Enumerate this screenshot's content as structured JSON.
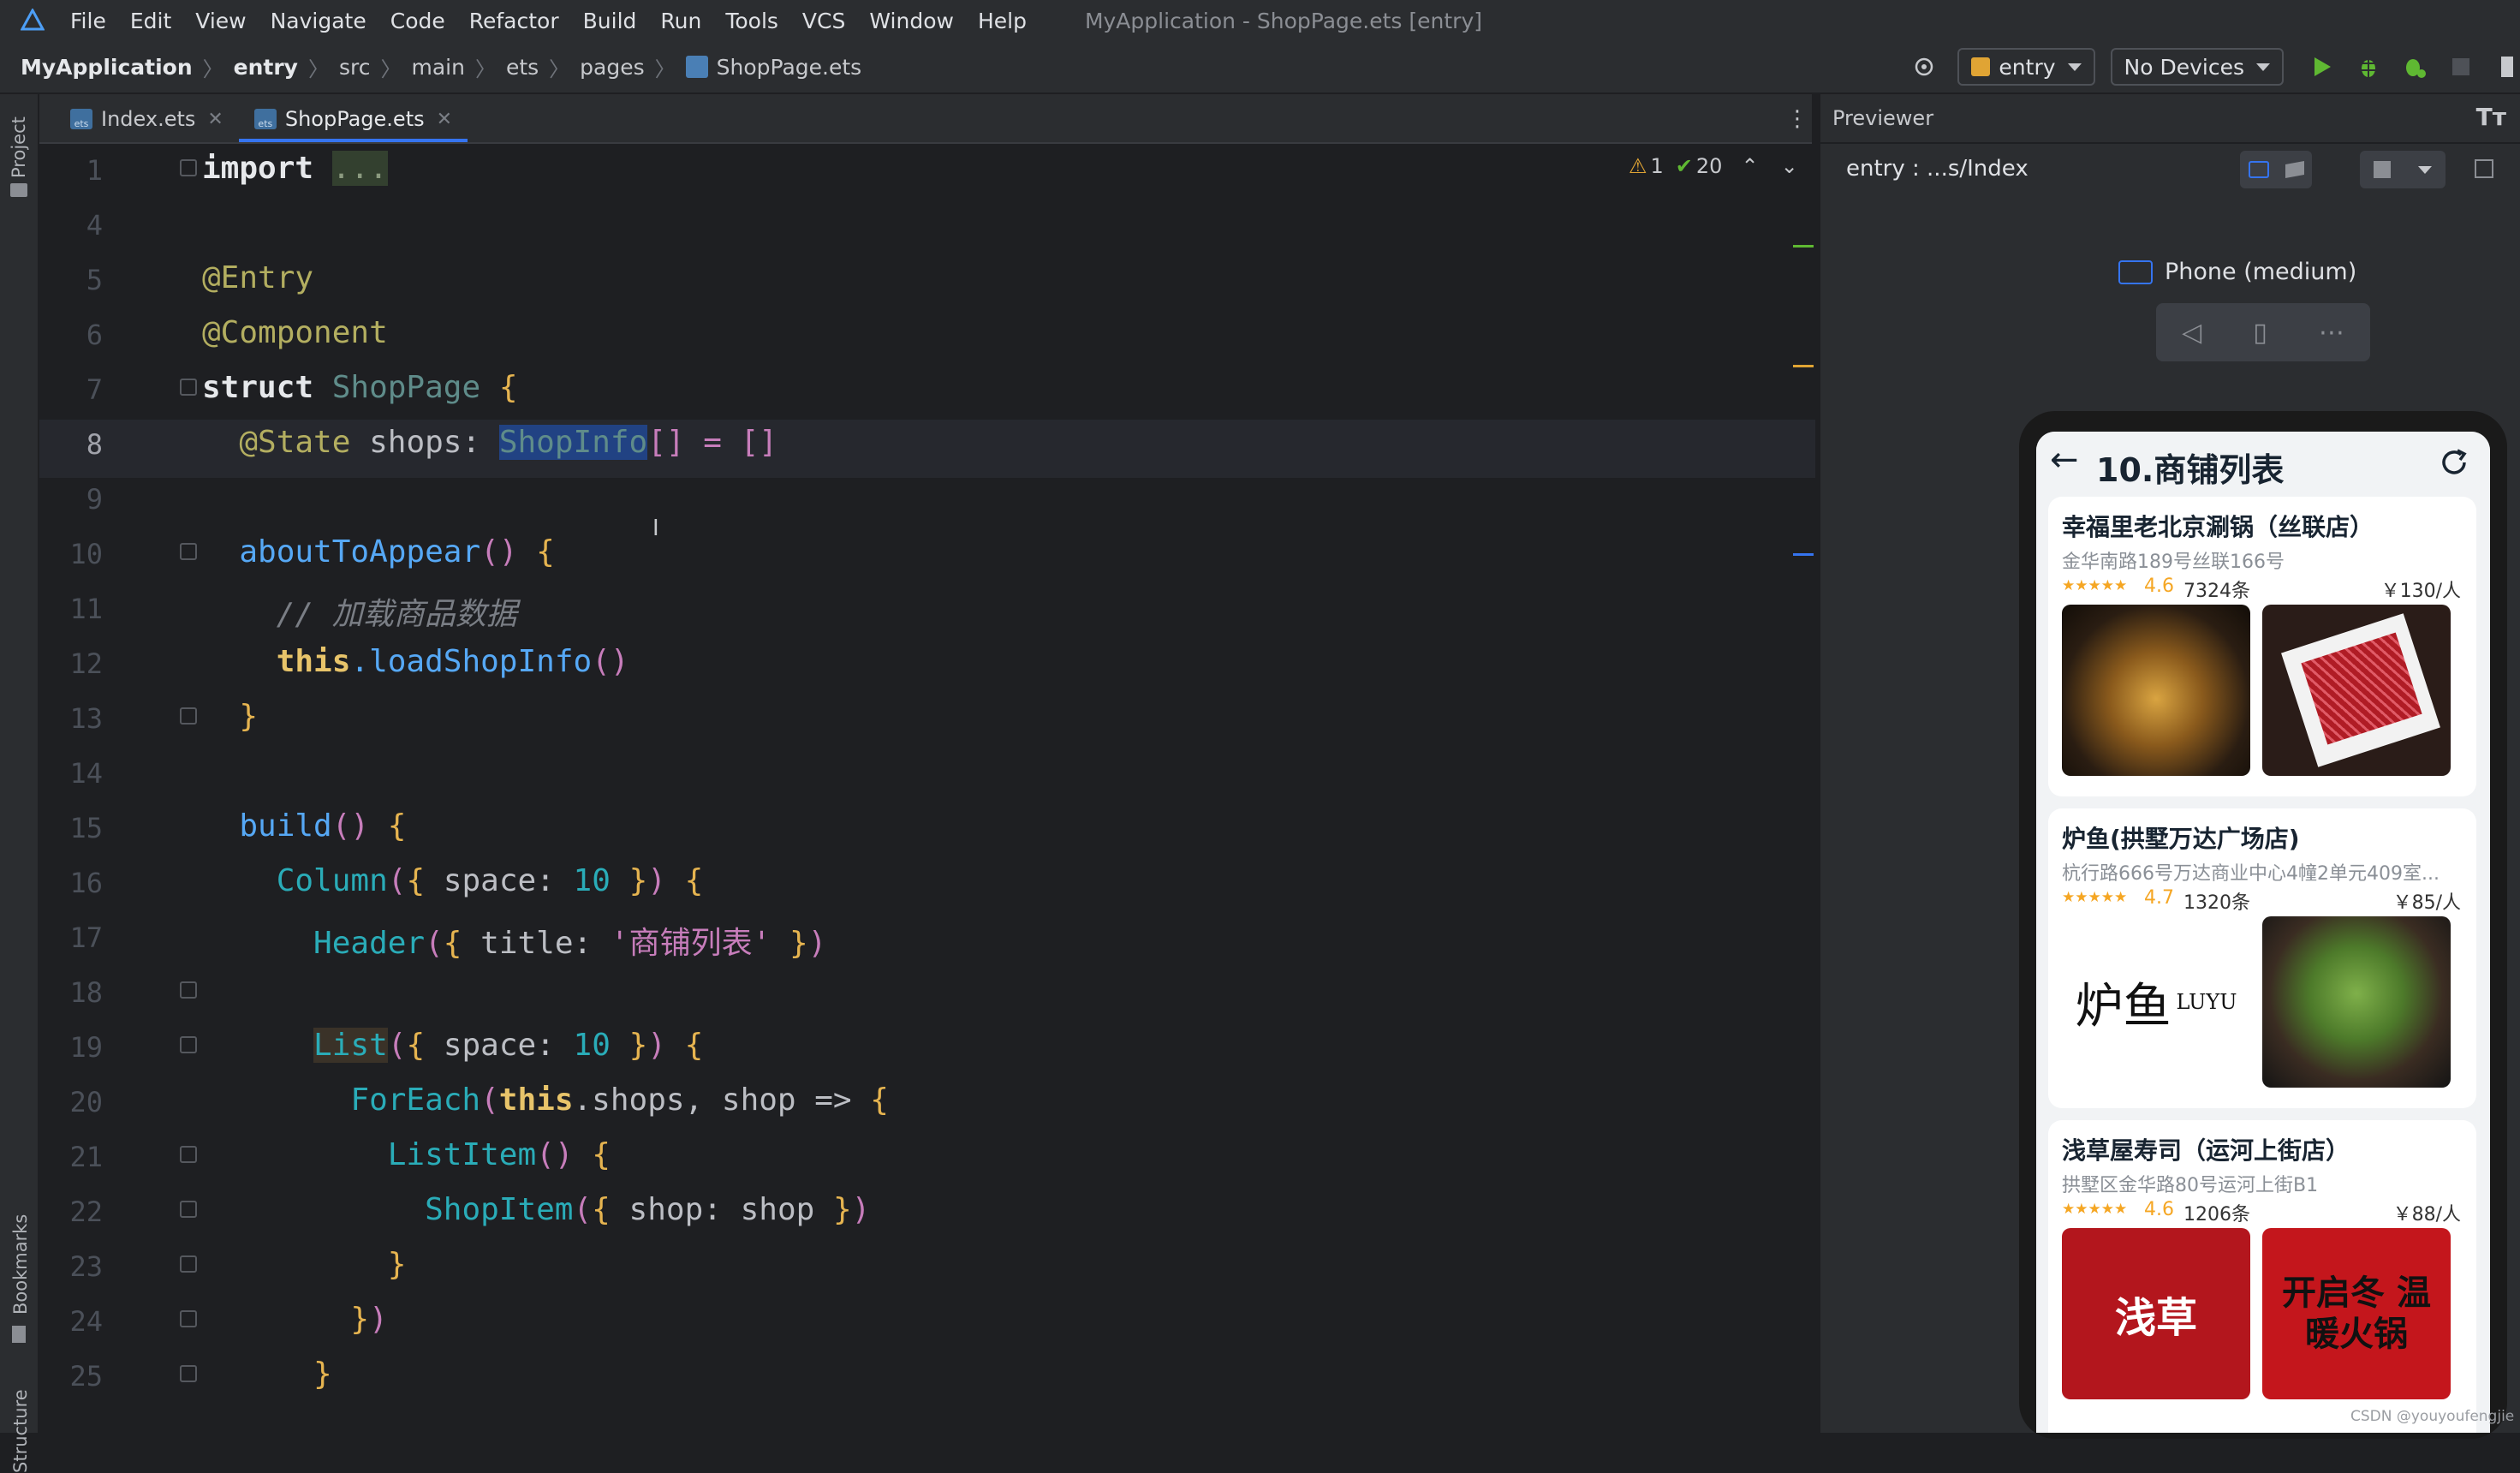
{
  "menubar": {
    "items": [
      "File",
      "Edit",
      "View",
      "Navigate",
      "Code",
      "Refactor",
      "Build",
      "Run",
      "Tools",
      "VCS",
      "Window",
      "Help"
    ],
    "window_title": "MyApplication - ShopPage.ets [entry]"
  },
  "navbar": {
    "breadcrumbs": [
      "MyApplication",
      "entry",
      "src",
      "main",
      "ets",
      "pages",
      "ShopPage.ets"
    ],
    "run_config": "entry",
    "device": "No Devices"
  },
  "left_strip": {
    "project": "Project",
    "bookmarks": "Bookmarks",
    "structure": "Structure"
  },
  "tabs": [
    {
      "label": "Index.ets",
      "icon_text": "ets"
    },
    {
      "label": "ShopPage.ets",
      "icon_text": "ets"
    }
  ],
  "inspection": {
    "warnings": "1",
    "ok": "20"
  },
  "editor": {
    "line_numbers": [
      "1",
      "4",
      "5",
      "6",
      "7",
      "8",
      "9",
      "10",
      "11",
      "12",
      "13",
      "14",
      "15",
      "16",
      "17",
      "18",
      "19",
      "20",
      "21",
      "22",
      "23",
      "24",
      "25"
    ],
    "current_line": "8",
    "code": {
      "l1_import": "import",
      "l1_dots": "...",
      "l5": "@Entry",
      "l6": "@Component",
      "l7_kw": "struct",
      "l7_name": "ShopPage",
      "l8_ann": "@State",
      "l8_var": "shops:",
      "l8_type": "ShopInfo",
      "l8_rest": "[] = []",
      "l10_fn": "aboutToAppear",
      "l11": "// 加载商品数据",
      "l12_this": "this",
      "l12_fn": ".loadShopInfo",
      "l15_fn": "build",
      "l16_fn": "Column",
      "l16_key": "space:",
      "l16_num": "10",
      "l17_fn": "Header",
      "l17_key": "title:",
      "l17_str": "'商铺列表'",
      "l19_fn": "List",
      "l19_key": "space:",
      "l19_num": "10",
      "l20_fn": "ForEach",
      "l20_this": "this",
      "l20_rest": ".shops, shop =>",
      "l21_fn": "ListItem",
      "l22_fn": "ShopItem",
      "l22_rest": "shop: shop"
    }
  },
  "previewer": {
    "title": "Previewer",
    "path": "entry : ...s/Index",
    "device_label": "Phone (medium)",
    "app": {
      "header_title": "10.商铺列表",
      "shops": [
        {
          "name": "幸福里老北京涮锅（丝联店）",
          "address": "金华南路189号丝联166号",
          "stars": "★★★★★",
          "score": "4.6",
          "count": "7324条",
          "price": "￥130/人"
        },
        {
          "name": "炉鱼(拱墅万达广场店)",
          "address": "杭行路666号万达商业中心4幢2单元409室...",
          "stars": "★★★★★",
          "score": "4.7",
          "count": "1320条",
          "price": "￥85/人",
          "logo_text": "炉鱼",
          "logo_sub": "LUYU"
        },
        {
          "name": "浅草屋寿司（运河上街店）",
          "address": "拱墅区金华路80号运河上街B1",
          "stars": "★★★★★",
          "score": "4.6",
          "count": "1206条",
          "price": "￥88/人",
          "poster1": "浅草",
          "poster2": "开启冬 温暖火锅"
        }
      ]
    }
  },
  "watermark": "CSDN @youyoufengjie",
  "colors": {
    "accent": "#3574f0",
    "run_green": "#5fb832",
    "background": "#1e1f22",
    "panel": "#2b2d30"
  }
}
